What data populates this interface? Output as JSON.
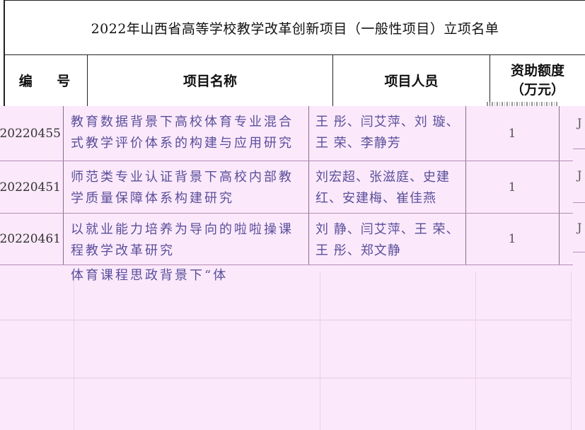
{
  "document": {
    "title": "2022年山西省高等学校教学改革创新项目（一般性项目）立项名单",
    "columns": {
      "id": "编 号",
      "name": "项目名称",
      "person": "项目人员",
      "fund_line1": "资助额度",
      "fund_line2": "（万元）"
    },
    "rows": [
      {
        "id": "20220455",
        "name_line1": "教育数据背景下高校体育专业混合",
        "name_line2": "式教学评价体系的构建与应用研究",
        "person_line1": "王 彤、闫艾萍、刘 璇、",
        "person_line2": "王 荣、李静芳",
        "fund": "1",
        "extra": "J"
      },
      {
        "id": "20220451",
        "name_line1": "师范类专业认证背景下高校内部教",
        "name_line2": "学质量保障体系构建研究",
        "person_line1": "刘宏超、张滋庭、史建",
        "person_line2": "红、安建梅、崔佳燕",
        "fund": "1",
        "extra": "J"
      },
      {
        "id": "20220461",
        "name_line1": "以就业能力培养为导向的啦啦操课",
        "name_line2": "程教学改革研究",
        "person_line1": "刘 静、闫艾萍、王 荣、",
        "person_line2": "王 彤、郑文静",
        "fund": "1",
        "extra": "J"
      }
    ],
    "partial_row_text": "体育课程思政背景下“体"
  }
}
